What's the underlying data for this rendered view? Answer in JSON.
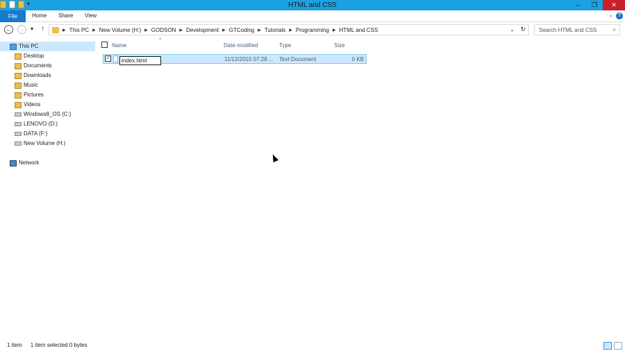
{
  "window": {
    "title": "HTML and CSS",
    "minimize": "–",
    "restore": "❐",
    "close": "✕"
  },
  "ribbon": {
    "file": "File",
    "tabs": [
      "Home",
      "Share",
      "View"
    ],
    "help": "?",
    "collapse": "⌄"
  },
  "nav": {
    "back": "←",
    "forward": "→",
    "recent": "▾",
    "up": "↑",
    "breadcrumb": [
      "This PC",
      "New Volume (H:)",
      "GODSON",
      "Development",
      "GTCoding",
      "Tutorials",
      "Programming",
      "HTML and CSS"
    ],
    "dropdown": "⌄",
    "refresh": "↻"
  },
  "search": {
    "placeholder": "Search HTML and CSS",
    "icon": "⌕"
  },
  "sidebar": {
    "this_pc": "This PC",
    "items": [
      "Desktop",
      "Documents",
      "Downloads",
      "Music",
      "Pictures",
      "Videos"
    ],
    "drives": [
      "Windows8_OS (C:)",
      "LENOVO (D:)",
      "DATA (F:)",
      "New Volume (H:)"
    ],
    "network": "Network"
  },
  "columns": {
    "name": "Name",
    "date": "Date modified",
    "type": "Type",
    "size": "Size",
    "sort": "˄"
  },
  "files": [
    {
      "name": "index.html",
      "date": "11/12/2015 07:28 ...",
      "type": "Text Document",
      "size": "0 KB",
      "checked": "✓"
    }
  ],
  "status": {
    "count": "1 item",
    "selected": "1 item selected  0 bytes"
  }
}
